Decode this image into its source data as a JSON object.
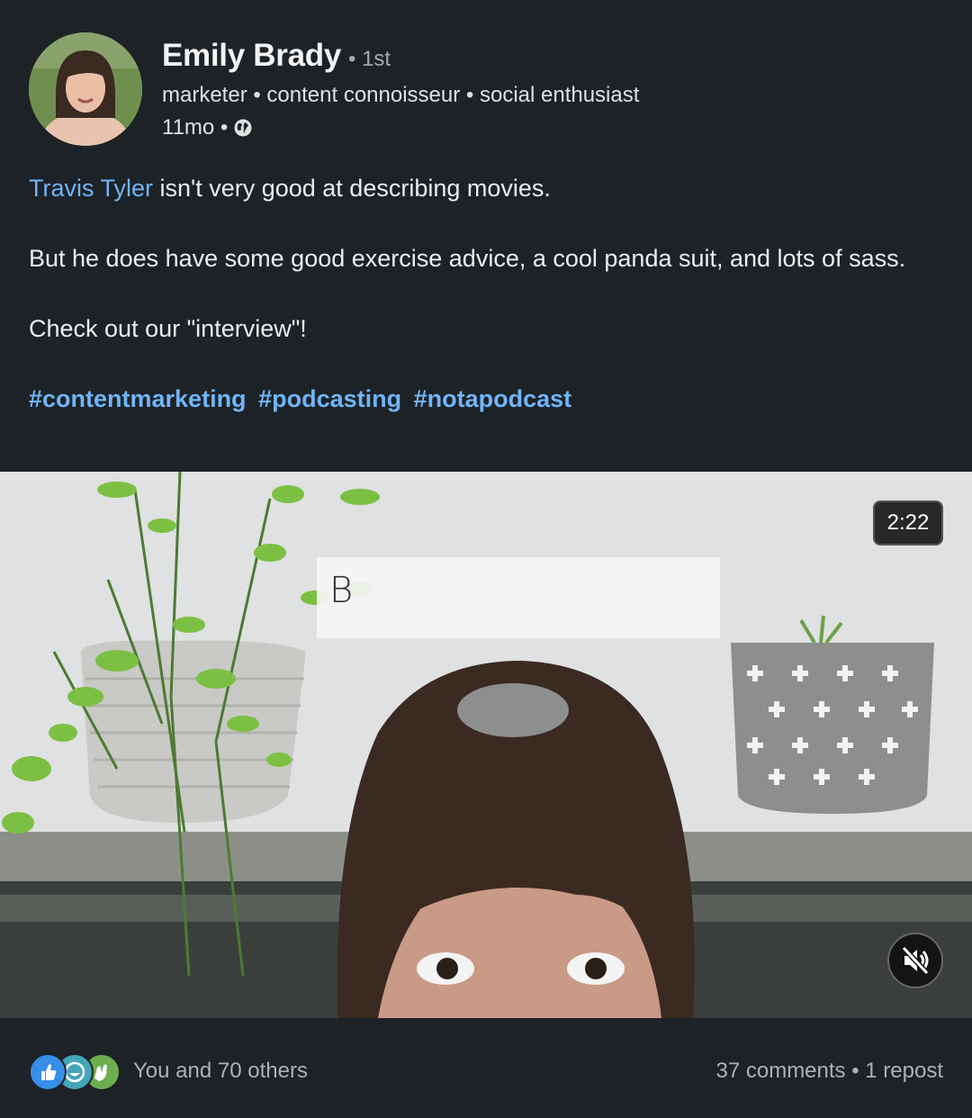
{
  "author": {
    "name": "Emily Brady",
    "degree": "• 1st",
    "headline": "marketer • content connoisseur • social enthusiast",
    "time": "11mo •",
    "visibility_icon": "globe-icon"
  },
  "post": {
    "mention": "Travis Tyler",
    "line1_rest": " isn't very good at describing movies.",
    "paragraph2": "But he does have some good exercise advice, a cool panda suit, and lots of sass.",
    "paragraph3": "Check out our \"interview\"!",
    "hashtags": [
      "#contentmarketing",
      "#podcasting",
      "#notapodcast"
    ]
  },
  "video": {
    "duration": "2:22",
    "title_card_text": "B",
    "mute_icon": "speaker-muted-icon"
  },
  "social": {
    "reaction_icons": [
      "like-icon",
      "funny-icon",
      "celebrate-icon"
    ],
    "reactions_text": "You and 70 others",
    "stats_text": "37 comments • 1 repost"
  },
  "colors": {
    "background": "#1d2226",
    "link": "#70b5f9",
    "like": "#378fe9",
    "funny": "#44a6b7",
    "celebrate": "#6dae4f"
  }
}
